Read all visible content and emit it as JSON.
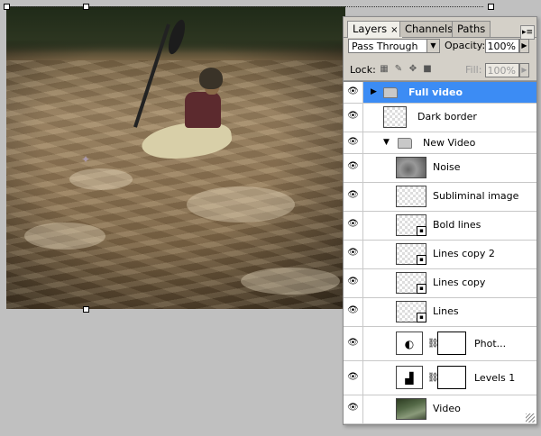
{
  "panel": {
    "tabs": [
      {
        "label": "Layers",
        "close": "×"
      },
      {
        "label": "Channels"
      },
      {
        "label": "Paths"
      }
    ],
    "menu_icon": "panel-menu-icon",
    "blend_mode": "Pass Through",
    "opacity_label": "Opacity:",
    "opacity_value": "100%",
    "lock_label": "Lock:",
    "fill_label": "Fill:",
    "fill_value": "100%"
  },
  "layers": [
    {
      "name": "Full video",
      "kind": "group",
      "selected": true,
      "expanded": false
    },
    {
      "name": "Dark border",
      "kind": "pixel"
    },
    {
      "name": "New Video",
      "kind": "group",
      "expanded": true
    },
    {
      "name": "Noise",
      "kind": "pixel"
    },
    {
      "name": "Subliminal image",
      "kind": "pixel"
    },
    {
      "name": "Bold lines",
      "kind": "smart"
    },
    {
      "name": "Lines copy 2",
      "kind": "smart"
    },
    {
      "name": "Lines copy",
      "kind": "smart"
    },
    {
      "name": "Lines",
      "kind": "smart"
    },
    {
      "name": "Phot...",
      "kind": "adjustment"
    },
    {
      "name": "Levels 1",
      "kind": "adjustment"
    },
    {
      "name": "Video",
      "kind": "pixel"
    }
  ]
}
